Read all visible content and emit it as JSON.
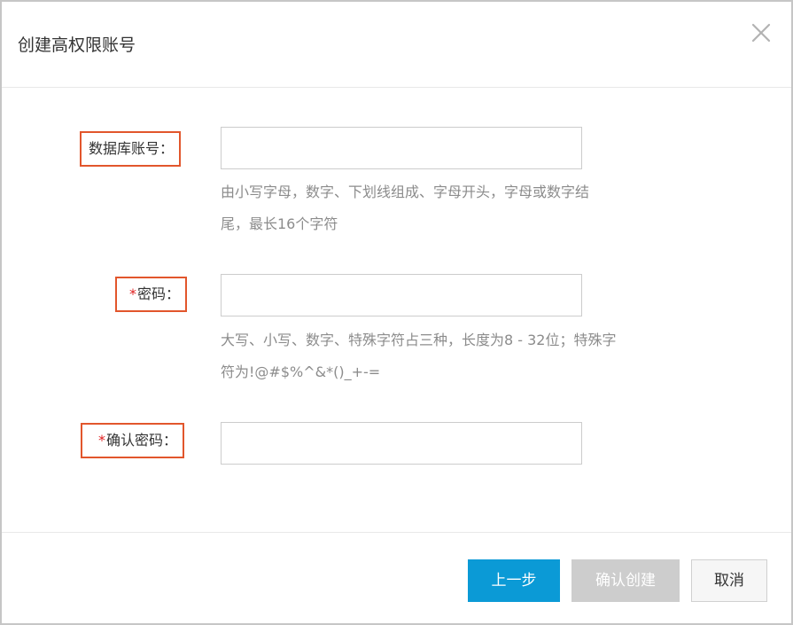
{
  "dialog": {
    "title": "创建高权限账号"
  },
  "form": {
    "account": {
      "required_mark": "",
      "label": "数据库账号：",
      "value": "",
      "placeholder": "",
      "hint_line1": "由小写字母，数字、下划线组成、字母开头，字母或数字结",
      "hint_line2": "尾，最长16个字符"
    },
    "password": {
      "required_mark": "*",
      "label": "密码：",
      "value": "",
      "placeholder": "",
      "hint_line1": "大写、小写、数字、特殊字符占三种，长度为8 - 32位；特殊字",
      "hint_line2": "符为!@#$%^&*()_+-="
    },
    "confirm_password": {
      "required_mark": "*",
      "label": "确认密码：",
      "value": "",
      "placeholder": ""
    }
  },
  "footer": {
    "prev_label": "上一步",
    "confirm_label": "确认创建",
    "cancel_label": "取消"
  },
  "colors": {
    "primary": "#0b9ad6",
    "disabled": "#cdcdcd",
    "highlight_border": "#e2562c",
    "required": "#e02020"
  },
  "icons": {
    "close": "close-icon"
  }
}
